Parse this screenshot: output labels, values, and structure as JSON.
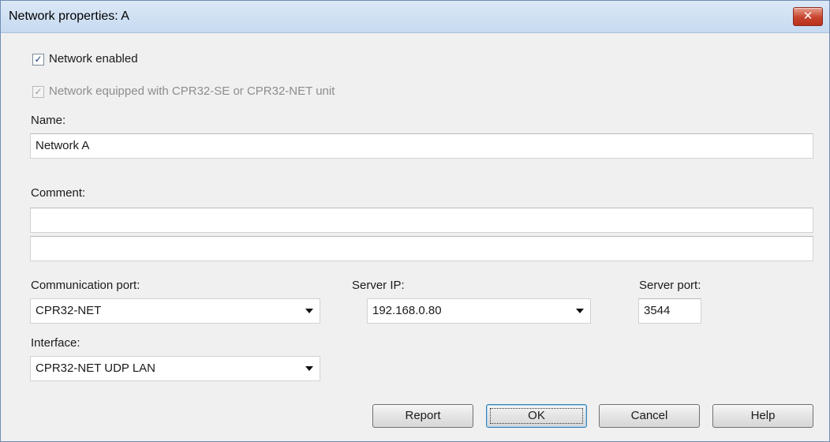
{
  "window": {
    "title": "Network properties: A",
    "close_glyph": "✕"
  },
  "checks": {
    "network_enabled": {
      "label": "Network enabled",
      "checked": true,
      "glyph": "✓"
    },
    "equipped": {
      "label": "Network equipped with CPR32-SE or CPR32-NET unit",
      "checked": true,
      "disabled": true,
      "glyph": "✓"
    }
  },
  "name": {
    "label": "Name:",
    "value": "Network A"
  },
  "comment": {
    "label": "Comment:",
    "line1": "",
    "line2": ""
  },
  "comm_port": {
    "label": "Communication port:",
    "value": "CPR32-NET"
  },
  "server_ip": {
    "label": "Server IP:",
    "value": "192.168.0.80"
  },
  "server_port": {
    "label": "Server port:",
    "value": "3544"
  },
  "interface": {
    "label": "Interface:",
    "value": "CPR32-NET UDP LAN"
  },
  "buttons": {
    "report": "Report",
    "ok": "OK",
    "cancel": "Cancel",
    "help": "Help"
  },
  "colors": {
    "dialog_bg": "#f0f0f0",
    "titlebar": "#c7daf0",
    "close_red": "#c7432d",
    "default_button_border": "#3c7fb1"
  },
  "icons": [
    "close-icon",
    "checkmark-icon",
    "dropdown-arrow-icon"
  ]
}
